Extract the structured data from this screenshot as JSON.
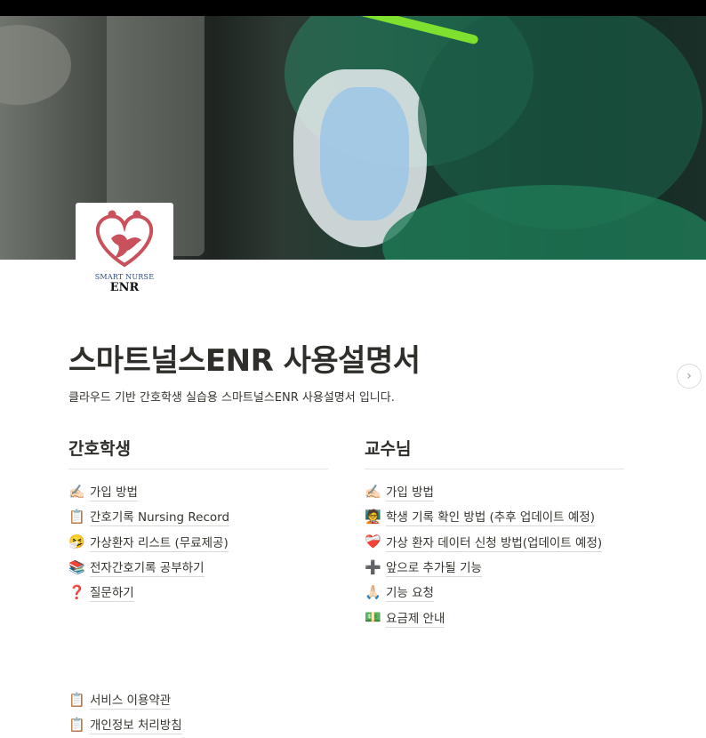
{
  "cover": {
    "logo": {
      "line1": "SMART NURSE",
      "line2": "ENR"
    }
  },
  "page": {
    "title": "스마트널스ENR 사용설명서",
    "description": "클라우드 기반 간호학생 실습용 스마트널스ENR 사용설명서 입니다."
  },
  "students": {
    "heading": "간호학생",
    "items": [
      {
        "icon": "writing-hand-icon",
        "glyph": "✍🏻",
        "label": "가입 방법"
      },
      {
        "icon": "clipboard-icon",
        "glyph": "📋",
        "label": "간호기록 Nursing Record"
      },
      {
        "icon": "sick-face-icon",
        "glyph": "🤧",
        "label": "가상환자 리스트 (무료제공)"
      },
      {
        "icon": "books-icon",
        "glyph": "📚",
        "label": "전자간호기록 공부하기"
      },
      {
        "icon": "question-mark-icon",
        "glyph": "❓",
        "label": "질문하기"
      }
    ]
  },
  "professors": {
    "heading": "교수님",
    "items": [
      {
        "icon": "writing-hand-icon",
        "glyph": "✍🏻",
        "label": "가입 방법"
      },
      {
        "icon": "teacher-icon",
        "glyph": "🧑‍🏫",
        "label": "학생 기록 확인 방법 (추후 업데이트 예정)"
      },
      {
        "icon": "mending-heart-icon",
        "glyph": "❤️‍🩹",
        "label": "가상 환자 데이터 신청 방법(업데이트 예정)"
      },
      {
        "icon": "plus-icon",
        "glyph": "➕",
        "label": "앞으로 추가될 기능"
      },
      {
        "icon": "praying-hands-icon",
        "glyph": "🙏🏻",
        "label": "기능 요청"
      },
      {
        "icon": "money-icon",
        "glyph": "💵",
        "label": "요금제 안내"
      }
    ]
  },
  "footer": {
    "items": [
      {
        "icon": "clipboard-icon",
        "glyph": "📋",
        "label": "서비스 이용약관"
      },
      {
        "icon": "clipboard-icon",
        "glyph": "📋",
        "label": "개인정보 처리방침"
      }
    ]
  },
  "nav": {
    "next_icon": "chevron-right-icon",
    "next_glyph": "›"
  },
  "colors": {
    "text": "#37352f",
    "title": "#2f2e2b",
    "divider": "#e5e5e3",
    "logo_heart": "#c9515c",
    "logo_text_blue": "#2c4a87"
  }
}
